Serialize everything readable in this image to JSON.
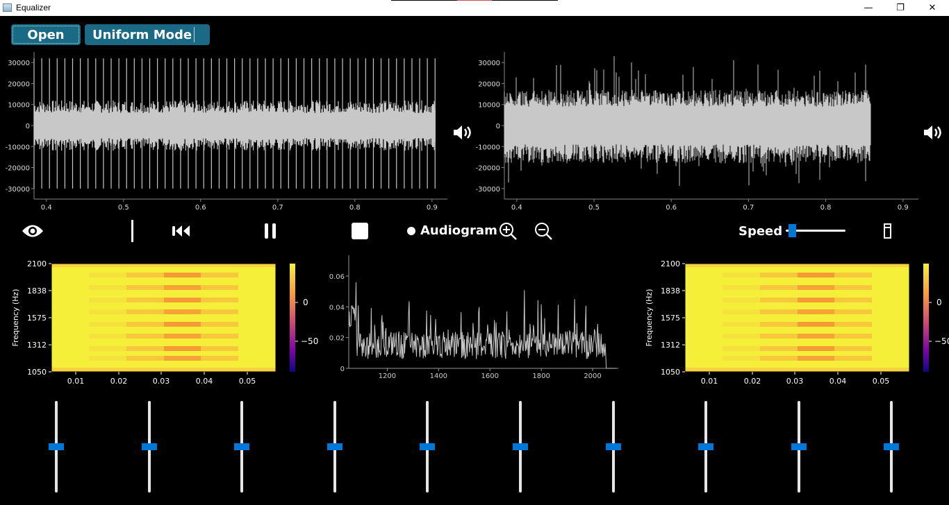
{
  "window": {
    "title": "Equalizer",
    "minimize": "—",
    "maximize": "❐",
    "close": "✕"
  },
  "toolbar": {
    "open_label": "Open",
    "mode_label": "Uniform Mode"
  },
  "input_plot": {
    "x_ticks": [
      "0.4",
      "0.5",
      "0.6",
      "0.7",
      "0.8",
      "0.9"
    ],
    "y_ticks": [
      "30000",
      "20000",
      "10000",
      "0",
      "-10000",
      "-20000",
      "-30000"
    ]
  },
  "output_plot": {
    "x_ticks": [
      "0.4",
      "0.5",
      "0.6",
      "0.7",
      "0.8",
      "0.9"
    ],
    "y_ticks": [
      "30000",
      "20000",
      "10000",
      "0",
      "-10000",
      "-20000",
      "-30000"
    ]
  },
  "controls": {
    "audiogram_label": "Audiogram",
    "speed_label": "Speed",
    "speed_value": 0.05,
    "icons": [
      "eye-icon",
      "cursor-bar-icon",
      "rewind-icon",
      "pause-icon",
      "stop-icon",
      "radio-dot-icon",
      "zoom-in-icon",
      "zoom-out-icon",
      "speaker-icon",
      "window-icon"
    ]
  },
  "spectrogram_left": {
    "ylabel": "Frequency (Hz)",
    "y_ticks": [
      "2100",
      "1838",
      "1575",
      "1312",
      "1050"
    ],
    "x_ticks": [
      "0.01",
      "0.02",
      "0.03",
      "0.04",
      "0.05"
    ],
    "colorbar_ticks": [
      "0",
      "−50"
    ]
  },
  "spectrogram_right": {
    "ylabel": "Frequency (Hz)",
    "y_ticks": [
      "2100",
      "1838",
      "1575",
      "1312",
      "1050"
    ],
    "x_ticks": [
      "0.01",
      "0.02",
      "0.03",
      "0.04",
      "0.05"
    ],
    "colorbar_ticks": [
      "0",
      "−50"
    ]
  },
  "spectrum_plot": {
    "x_ticks": [
      "1200",
      "1400",
      "1600",
      "1800",
      "2000"
    ],
    "y_ticks": [
      "0.06",
      "0.04",
      "0.02",
      "0"
    ]
  },
  "sliders": {
    "count": 10,
    "values": [
      0.5,
      0.5,
      0.5,
      0.5,
      0.5,
      0.5,
      0.5,
      0.5,
      0.5,
      0.5
    ]
  },
  "colors": {
    "accent": "#0078d7",
    "button": "#1b6a85",
    "signal": "#c8c8c8"
  }
}
